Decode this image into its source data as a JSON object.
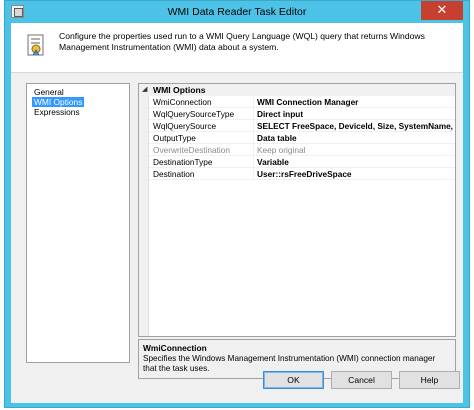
{
  "window": {
    "title": "WMI Data Reader Task Editor",
    "close_glyph": "✕"
  },
  "header": {
    "description": "Configure the properties used run to a WMI Query Language (WQL) query that returns Windows Management Instrumentation (WMI) data about a system."
  },
  "nav": {
    "items": [
      {
        "label": "General",
        "selected": false
      },
      {
        "label": "WMI Options",
        "selected": true
      },
      {
        "label": "Expressions",
        "selected": false
      }
    ]
  },
  "grid": {
    "category": {
      "label": "WMI Options",
      "toggle": "◢"
    },
    "rows": [
      {
        "name": "WmiConnection",
        "value": "WMI Connection Manager",
        "disabled": false
      },
      {
        "name": "WqlQuerySourceType",
        "value": "Direct input",
        "disabled": false
      },
      {
        "name": "WqlQuerySource",
        "value": "SELECT FreeSpace, DeviceId, Size, SystemName, Descriptio",
        "disabled": false
      },
      {
        "name": "OutputType",
        "value": "Data table",
        "disabled": false
      },
      {
        "name": "OverwriteDestination",
        "value": "Keep original",
        "disabled": true
      },
      {
        "name": "DestinationType",
        "value": "Variable",
        "disabled": false
      },
      {
        "name": "Destination",
        "value": "User::rsFreeDriveSpace",
        "disabled": false
      }
    ]
  },
  "description_panel": {
    "title": "WmiConnection",
    "text": "Specifies the Windows Management Instrumentation (WMI) connection manager that the task uses."
  },
  "buttons": {
    "ok": "OK",
    "cancel": "Cancel",
    "help": "Help"
  },
  "colors": {
    "frame": "#4cc2e7",
    "close": "#c7402f",
    "selection": "#3399ff"
  }
}
